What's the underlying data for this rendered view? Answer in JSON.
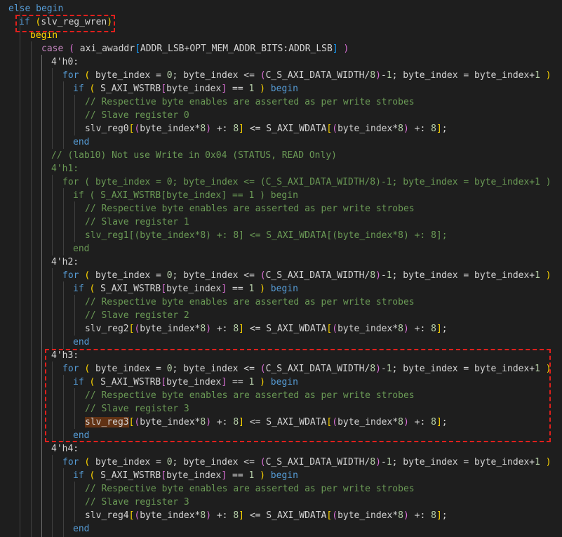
{
  "editor": {
    "lines": [
      [
        [
          "kw",
          "else begin"
        ]
      ],
      [
        [
          "kw",
          "if"
        ],
        [
          "plain",
          " "
        ],
        [
          "br1",
          "("
        ],
        [
          "plain",
          "slv_reg_wren"
        ],
        [
          "br1",
          ")"
        ]
      ],
      [
        [
          "br1",
          "begin"
        ]
      ],
      [
        [
          "ctl",
          "case"
        ],
        [
          "plain",
          " "
        ],
        [
          "br2",
          "("
        ],
        [
          "plain",
          " axi_awaddr"
        ],
        [
          "br3",
          "["
        ],
        [
          "plain",
          "ADDR_LSB+OPT_MEM_ADDR_BITS:ADDR_LSB"
        ],
        [
          "br3",
          "]"
        ],
        [
          "plain",
          " "
        ],
        [
          "br2",
          ")"
        ]
      ],
      [
        [
          "plain",
          "4'h0:"
        ]
      ],
      [
        [
          "kw",
          "for"
        ],
        [
          "plain",
          " "
        ],
        [
          "br1",
          "("
        ],
        [
          "plain",
          " byte_index = "
        ],
        [
          "num",
          "0"
        ],
        [
          "plain",
          "; byte_index <= "
        ],
        [
          "br2",
          "("
        ],
        [
          "plain",
          "C_S_AXI_DATA_WIDTH/"
        ],
        [
          "num",
          "8"
        ],
        [
          "br2",
          ")"
        ],
        [
          "plain",
          "-"
        ],
        [
          "num",
          "1"
        ],
        [
          "plain",
          "; byte_index = byte_index+"
        ],
        [
          "num",
          "1"
        ],
        [
          "plain",
          " "
        ],
        [
          "br1",
          ")"
        ]
      ],
      [
        [
          "kw",
          "if"
        ],
        [
          "plain",
          " "
        ],
        [
          "br1",
          "("
        ],
        [
          "plain",
          " S_AXI_WSTRB"
        ],
        [
          "br2",
          "["
        ],
        [
          "plain",
          "byte_index"
        ],
        [
          "br2",
          "]"
        ],
        [
          "plain",
          " == "
        ],
        [
          "num",
          "1"
        ],
        [
          "plain",
          " "
        ],
        [
          "br1",
          ")"
        ],
        [
          "plain",
          " "
        ],
        [
          "kw",
          "begin"
        ]
      ],
      [
        [
          "cm",
          "// Respective byte enables are asserted as per write strobes"
        ]
      ],
      [
        [
          "cm",
          "// Slave register 0"
        ]
      ],
      [
        [
          "plain",
          "slv_reg0"
        ],
        [
          "br1",
          "["
        ],
        [
          "br2",
          "("
        ],
        [
          "plain",
          "byte_index*"
        ],
        [
          "num",
          "8"
        ],
        [
          "br2",
          ")"
        ],
        [
          "plain",
          " +: "
        ],
        [
          "num",
          "8"
        ],
        [
          "br1",
          "]"
        ],
        [
          "plain",
          " <= S_AXI_WDATA"
        ],
        [
          "br1",
          "["
        ],
        [
          "br2",
          "("
        ],
        [
          "plain",
          "byte_index*"
        ],
        [
          "num",
          "8"
        ],
        [
          "br2",
          ")"
        ],
        [
          "plain",
          " +: "
        ],
        [
          "num",
          "8"
        ],
        [
          "br1",
          "]"
        ],
        [
          "plain",
          ";"
        ]
      ],
      [
        [
          "kw",
          "end"
        ]
      ],
      [
        [
          "cm",
          "// (lab10) Not use Write in 0x04 (STATUS, READ Only)"
        ]
      ],
      [
        [
          "cm",
          "4'h1:"
        ]
      ],
      [
        [
          "cm",
          "for ( byte_index = 0; byte_index <= (C_S_AXI_DATA_WIDTH/8)-1; byte_index = byte_index+1 )"
        ]
      ],
      [
        [
          "cm",
          "if ( S_AXI_WSTRB[byte_index] == 1 ) begin"
        ]
      ],
      [
        [
          "cm",
          "// Respective byte enables are asserted as per write strobes"
        ]
      ],
      [
        [
          "cm",
          "// Slave register 1"
        ]
      ],
      [
        [
          "cm",
          "slv_reg1[(byte_index*8) +: 8] <= S_AXI_WDATA[(byte_index*8) +: 8];"
        ]
      ],
      [
        [
          "cm",
          "end"
        ]
      ],
      [
        [
          "plain",
          "4'h2:"
        ]
      ],
      [
        [
          "kw",
          "for"
        ],
        [
          "plain",
          " "
        ],
        [
          "br1",
          "("
        ],
        [
          "plain",
          " byte_index = "
        ],
        [
          "num",
          "0"
        ],
        [
          "plain",
          "; byte_index <= "
        ],
        [
          "br2",
          "("
        ],
        [
          "plain",
          "C_S_AXI_DATA_WIDTH/"
        ],
        [
          "num",
          "8"
        ],
        [
          "br2",
          ")"
        ],
        [
          "plain",
          "-"
        ],
        [
          "num",
          "1"
        ],
        [
          "plain",
          "; byte_index = byte_index+"
        ],
        [
          "num",
          "1"
        ],
        [
          "plain",
          " "
        ],
        [
          "br1",
          ")"
        ]
      ],
      [
        [
          "kw",
          "if"
        ],
        [
          "plain",
          " "
        ],
        [
          "br1",
          "("
        ],
        [
          "plain",
          " S_AXI_WSTRB"
        ],
        [
          "br2",
          "["
        ],
        [
          "plain",
          "byte_index"
        ],
        [
          "br2",
          "]"
        ],
        [
          "plain",
          " == "
        ],
        [
          "num",
          "1"
        ],
        [
          "plain",
          " "
        ],
        [
          "br1",
          ")"
        ],
        [
          "plain",
          " "
        ],
        [
          "kw",
          "begin"
        ]
      ],
      [
        [
          "cm",
          "// Respective byte enables are asserted as per write strobes"
        ]
      ],
      [
        [
          "cm",
          "// Slave register 2"
        ]
      ],
      [
        [
          "plain",
          "slv_reg2"
        ],
        [
          "br1",
          "["
        ],
        [
          "br2",
          "("
        ],
        [
          "plain",
          "byte_index*"
        ],
        [
          "num",
          "8"
        ],
        [
          "br2",
          ")"
        ],
        [
          "plain",
          " +: "
        ],
        [
          "num",
          "8"
        ],
        [
          "br1",
          "]"
        ],
        [
          "plain",
          " <= S_AXI_WDATA"
        ],
        [
          "br1",
          "["
        ],
        [
          "br2",
          "("
        ],
        [
          "plain",
          "byte_index*"
        ],
        [
          "num",
          "8"
        ],
        [
          "br2",
          ")"
        ],
        [
          "plain",
          " +: "
        ],
        [
          "num",
          "8"
        ],
        [
          "br1",
          "]"
        ],
        [
          "plain",
          ";"
        ]
      ],
      [
        [
          "kw",
          "end"
        ]
      ],
      [
        [
          "plain",
          "4'h3:"
        ]
      ],
      [
        [
          "kw",
          "for"
        ],
        [
          "plain",
          " "
        ],
        [
          "br1",
          "("
        ],
        [
          "plain",
          " byte_index = "
        ],
        [
          "num",
          "0"
        ],
        [
          "plain",
          "; byte_index <= "
        ],
        [
          "br2",
          "("
        ],
        [
          "plain",
          "C_S_AXI_DATA_WIDTH/"
        ],
        [
          "num",
          "8"
        ],
        [
          "br2",
          ")"
        ],
        [
          "plain",
          "-"
        ],
        [
          "num",
          "1"
        ],
        [
          "plain",
          "; byte_index = byte_index+"
        ],
        [
          "num",
          "1"
        ],
        [
          "plain",
          " "
        ],
        [
          "br1",
          ")"
        ]
      ],
      [
        [
          "kw",
          "if"
        ],
        [
          "plain",
          " "
        ],
        [
          "br1",
          "("
        ],
        [
          "plain",
          " S_AXI_WSTRB"
        ],
        [
          "br2",
          "["
        ],
        [
          "plain",
          "byte_index"
        ],
        [
          "br2",
          "]"
        ],
        [
          "plain",
          " == "
        ],
        [
          "num",
          "1"
        ],
        [
          "plain",
          " "
        ],
        [
          "br1",
          ")"
        ],
        [
          "plain",
          " "
        ],
        [
          "kw",
          "begin"
        ]
      ],
      [
        [
          "cm",
          "// Respective byte enables are asserted as per write strobes"
        ]
      ],
      [
        [
          "cm",
          "// Slave register 3"
        ]
      ],
      [
        [
          "sel",
          "slv_reg3"
        ],
        [
          "br1",
          "["
        ],
        [
          "br2",
          "("
        ],
        [
          "plain",
          "byte_index*"
        ],
        [
          "num",
          "8"
        ],
        [
          "br2",
          ")"
        ],
        [
          "plain",
          " +: "
        ],
        [
          "num",
          "8"
        ],
        [
          "br1",
          "]"
        ],
        [
          "plain",
          " <= S_AXI_WDATA"
        ],
        [
          "br1",
          "["
        ],
        [
          "br2",
          "("
        ],
        [
          "plain",
          "byte_index*"
        ],
        [
          "num",
          "8"
        ],
        [
          "br2",
          ")"
        ],
        [
          "plain",
          " +: "
        ],
        [
          "num",
          "8"
        ],
        [
          "br1",
          "]"
        ],
        [
          "plain",
          ";"
        ]
      ],
      [
        [
          "kw",
          "end"
        ]
      ],
      [
        [
          "plain",
          "4'h4:"
        ]
      ],
      [
        [
          "kw",
          "for"
        ],
        [
          "plain",
          " "
        ],
        [
          "br1",
          "("
        ],
        [
          "plain",
          " byte_index = "
        ],
        [
          "num",
          "0"
        ],
        [
          "plain",
          "; byte_index <= "
        ],
        [
          "br2",
          "("
        ],
        [
          "plain",
          "C_S_AXI_DATA_WIDTH/"
        ],
        [
          "num",
          "8"
        ],
        [
          "br2",
          ")"
        ],
        [
          "plain",
          "-"
        ],
        [
          "num",
          "1"
        ],
        [
          "plain",
          "; byte_index = byte_index+"
        ],
        [
          "num",
          "1"
        ],
        [
          "plain",
          " "
        ],
        [
          "br1",
          ")"
        ]
      ],
      [
        [
          "kw",
          "if"
        ],
        [
          "plain",
          " "
        ],
        [
          "br1",
          "("
        ],
        [
          "plain",
          " S_AXI_WSTRB"
        ],
        [
          "br2",
          "["
        ],
        [
          "plain",
          "byte_index"
        ],
        [
          "br2",
          "]"
        ],
        [
          "plain",
          " == "
        ],
        [
          "num",
          "1"
        ],
        [
          "plain",
          " "
        ],
        [
          "br1",
          ")"
        ],
        [
          "plain",
          " "
        ],
        [
          "kw",
          "begin"
        ]
      ],
      [
        [
          "cm",
          "// Respective byte enables are asserted as per write strobes"
        ]
      ],
      [
        [
          "cm",
          "// Slave register 3"
        ]
      ],
      [
        [
          "plain",
          "slv_reg4"
        ],
        [
          "br1",
          "["
        ],
        [
          "br2",
          "("
        ],
        [
          "plain",
          "byte_index*"
        ],
        [
          "num",
          "8"
        ],
        [
          "br2",
          ")"
        ],
        [
          "plain",
          " +: "
        ],
        [
          "num",
          "8"
        ],
        [
          "br1",
          "]"
        ],
        [
          "plain",
          " <= S_AXI_WDATA"
        ],
        [
          "br1",
          "["
        ],
        [
          "br2",
          "("
        ],
        [
          "plain",
          "byte_index*"
        ],
        [
          "num",
          "8"
        ],
        [
          "br2",
          ")"
        ],
        [
          "plain",
          " +: "
        ],
        [
          "num",
          "8"
        ],
        [
          "br1",
          "]"
        ],
        [
          "plain",
          ";"
        ]
      ],
      [
        [
          "kw",
          "end"
        ]
      ]
    ]
  },
  "colors": {
    "background": "#1e1e1e",
    "keyword": "#569cd6",
    "control": "#c586c0",
    "comment": "#6a9955",
    "number": "#b5cea8",
    "bracket_1": "#ffd700",
    "bracket_2": "#da70d6",
    "bracket_3": "#179fff",
    "annotation_box": "#e0201c",
    "selection_highlight": "#613214"
  }
}
